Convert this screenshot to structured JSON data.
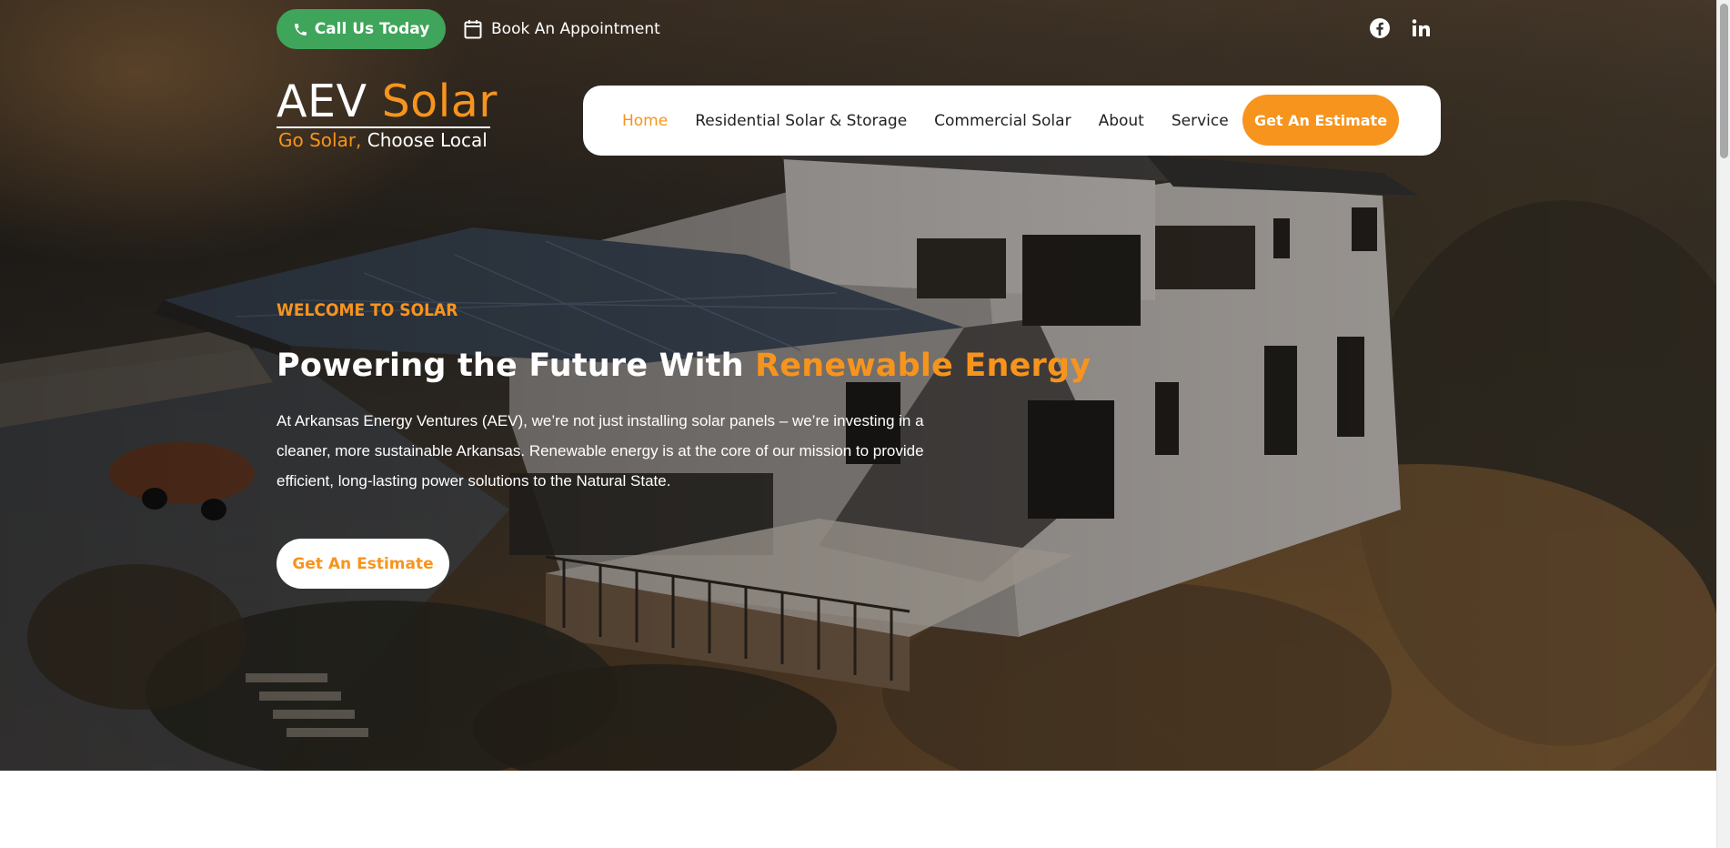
{
  "colors": {
    "accent": "#f7941d",
    "call_button": "#3ea55a",
    "nav_background": "#ffffff"
  },
  "topbar": {
    "call_label": "Call Us Today",
    "call_icon": "phone-icon",
    "appointment_label": "Book An Appointment",
    "appointment_icon": "calendar-icon",
    "social": [
      "facebook-icon",
      "linkedin-icon"
    ]
  },
  "logo": {
    "word1": "AEV",
    "word2": "Solar",
    "tagline_a": "Go Solar,",
    "tagline_b": "Choose Local"
  },
  "nav": {
    "items": [
      {
        "label": "Home",
        "active": true
      },
      {
        "label": "Residential Solar & Storage",
        "active": false
      },
      {
        "label": "Commercial Solar",
        "active": false
      },
      {
        "label": "About",
        "active": false
      },
      {
        "label": "Service",
        "active": false
      }
    ],
    "cta_label": "Get An Estimate"
  },
  "hero": {
    "eyebrow": "WELCOME TO SOLAR",
    "headline_a": "Powering the Future With",
    "headline_b": "Renewable Energy",
    "intro": "At Arkansas Energy Ventures (AEV), we’re not just installing solar panels  – we’re investing in a cleaner, more sustainable Arkansas. Renewable energy is at the core of our mission to provide efficient, long-lasting power solutions to the Natural State.",
    "cta_label": "Get An Estimate"
  }
}
